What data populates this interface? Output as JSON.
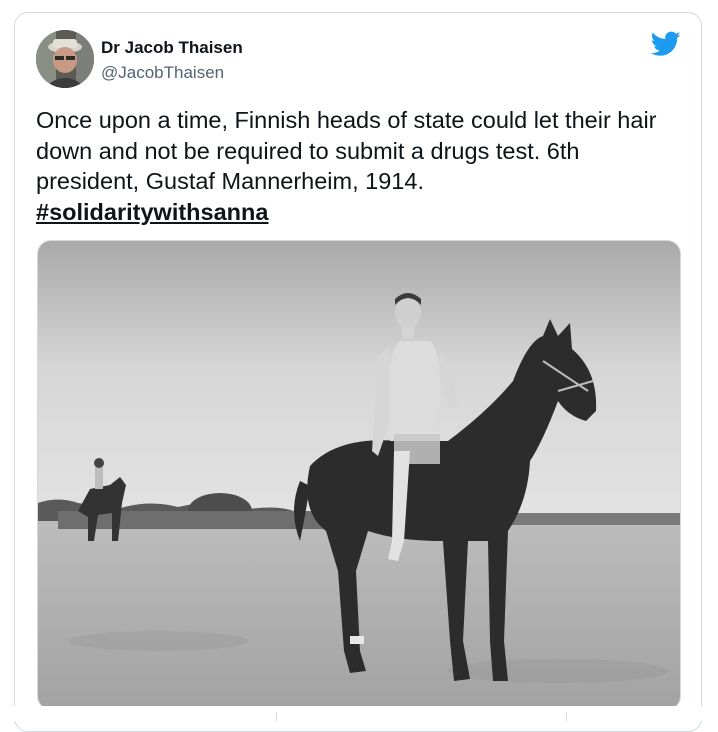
{
  "tweet": {
    "display_name": "Dr Jacob Thaisen",
    "handle": "@JacobThaisen",
    "text": "Once upon a time, Finnish heads of state could let their hair down and not be required to submit a drugs test. 6th president, Gustaf Mannerheim, 1914.",
    "hashtag": "#solidaritywithsanna",
    "avatar_icon": "user-avatar",
    "brand_icon": "twitter-bird-icon",
    "brand_color": "#1d9bf0"
  },
  "photo": {
    "subject": "vintage-photo-horse-rider",
    "style": "black-and-white"
  }
}
